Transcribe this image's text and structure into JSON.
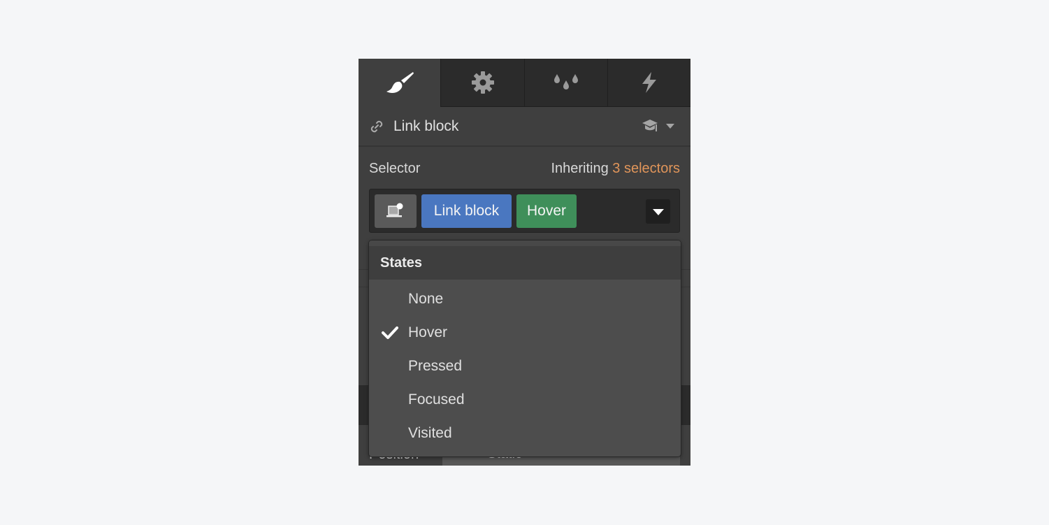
{
  "tabs": [
    {
      "name": "style",
      "icon": "paintbrush-icon",
      "active": true
    },
    {
      "name": "settings",
      "icon": "gear-icon",
      "active": false
    },
    {
      "name": "style-manager",
      "icon": "drops-icon",
      "active": false
    },
    {
      "name": "interactions",
      "icon": "lightning-icon",
      "active": false
    }
  ],
  "element": {
    "icon": "link-icon",
    "title": "Link block",
    "help_icon": "graduation-cap-icon"
  },
  "selector": {
    "label": "Selector",
    "inheriting_prefix": "Inheriting",
    "inheriting_count": "3 selectors",
    "device_icon": "device-state-icon",
    "chips": [
      {
        "label": "Link block",
        "type": "class",
        "color": "#4a77c0"
      },
      {
        "label": "Hover",
        "type": "state",
        "color": "#3f8f5a"
      }
    ]
  },
  "states_menu": {
    "header": "States",
    "items": [
      {
        "label": "None",
        "checked": false
      },
      {
        "label": "Hover",
        "checked": true
      },
      {
        "label": "Pressed",
        "checked": false
      },
      {
        "label": "Focused",
        "checked": false
      },
      {
        "label": "Visited",
        "checked": false
      }
    ]
  },
  "background": {
    "position_label": "Position",
    "position_value": "Static"
  },
  "colors": {
    "accent_orange": "#e0955a",
    "class_chip": "#4a77c0",
    "state_chip": "#3f8f5a"
  }
}
